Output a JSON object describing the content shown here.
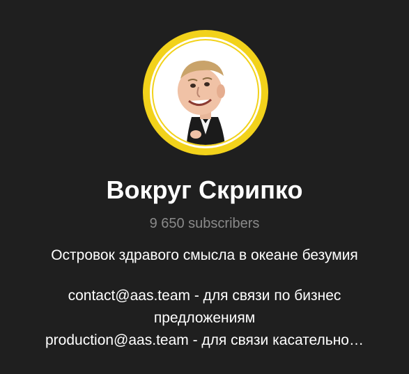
{
  "channel": {
    "title": "Вокруг Скрипко",
    "subscribers": "9 650 subscribers",
    "description": {
      "tagline": "Островок здравого смысла в океане безумия",
      "contact_line_1": "contact@aas.team - для связи по бизнес",
      "contact_line_2": "предложениям",
      "production_line": "production@aas.team - для связи касательно…"
    }
  },
  "colors": {
    "background": "#1f1f1f",
    "avatar_ring": "#f2d21b",
    "title": "#ffffff",
    "subscribers": "#8a8a8a",
    "description": "#ffffff"
  },
  "icons": {
    "avatar": "caricature-man-in-suit-avatar"
  }
}
